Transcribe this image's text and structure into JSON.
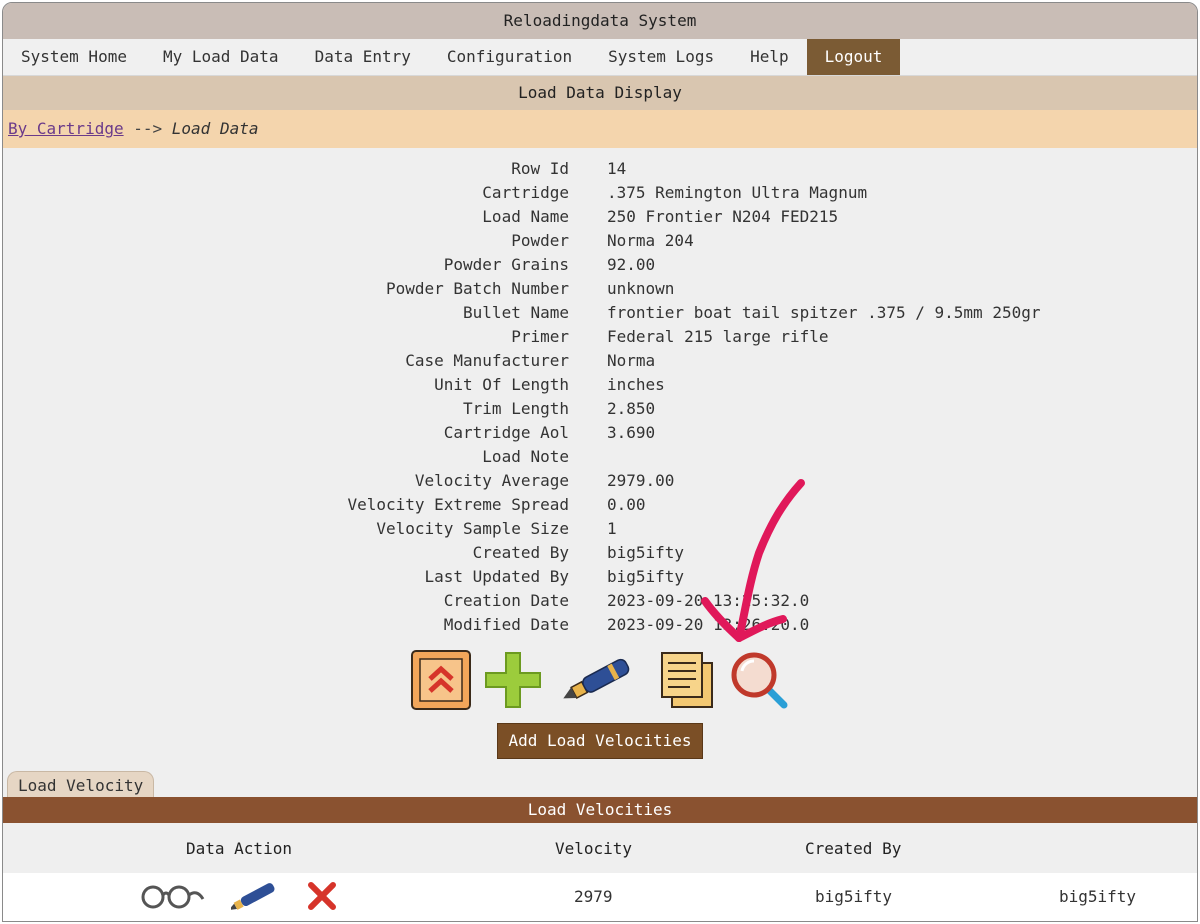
{
  "window": {
    "title": "Reloadingdata System"
  },
  "nav": {
    "items": [
      {
        "label": "System Home"
      },
      {
        "label": "My Load Data"
      },
      {
        "label": "Data Entry"
      },
      {
        "label": "Configuration"
      },
      {
        "label": "System Logs"
      },
      {
        "label": "Help"
      },
      {
        "label": "Logout"
      }
    ],
    "active": "Logout"
  },
  "section": {
    "title": "Load Data Display"
  },
  "breadcrumb": {
    "link": "By Cartridge",
    "separator": "-->",
    "current": "Load Data"
  },
  "details": [
    {
      "label": "Row Id",
      "value": "14"
    },
    {
      "label": "Cartridge",
      "value": ".375 Remington Ultra Magnum"
    },
    {
      "label": "Load Name",
      "value": "250 Frontier N204 FED215"
    },
    {
      "label": "Powder",
      "value": "Norma 204"
    },
    {
      "label": "Powder Grains",
      "value": "92.00"
    },
    {
      "label": "Powder Batch Number",
      "value": "unknown"
    },
    {
      "label": "Bullet Name",
      "value": "frontier boat tail spitzer .375 / 9.5mm 250gr"
    },
    {
      "label": "Primer",
      "value": "Federal 215 large rifle"
    },
    {
      "label": "Case Manufacturer",
      "value": "Norma"
    },
    {
      "label": "Unit Of Length",
      "value": "inches"
    },
    {
      "label": "Trim Length",
      "value": "2.850"
    },
    {
      "label": "Cartridge Aol",
      "value": "3.690"
    },
    {
      "label": "Load Note",
      "value": ""
    },
    {
      "label": "Velocity Average",
      "value": "2979.00"
    },
    {
      "label": "Velocity Extreme Spread",
      "value": "0.00"
    },
    {
      "label": "Velocity Sample Size",
      "value": "1"
    },
    {
      "label": "Created By",
      "value": "big5ifty"
    },
    {
      "label": "Last Updated By",
      "value": "big5ifty"
    },
    {
      "label": "Creation Date",
      "value": "2023-09-20 13:25:32.0"
    },
    {
      "label": "Modified Date",
      "value": "2023-09-20 13:26:20.0"
    }
  ],
  "actions": {
    "icons": [
      "back-to-top-icon",
      "add-icon",
      "edit-pen-icon",
      "copy-documents-icon",
      "search-magnifier-icon"
    ],
    "add_velocities_label": "Add Load Velocities"
  },
  "velocity_tab": {
    "label": "Load Velocity"
  },
  "velocities": {
    "title": "Load Velocities",
    "columns": [
      "Data Action",
      "Velocity",
      "Created By"
    ],
    "rows": [
      {
        "velocity": "2979",
        "created_by": "big5ifty",
        "updated_by": "big5ifty"
      }
    ],
    "row_icons": [
      "view-glasses-icon",
      "edit-pen-icon",
      "delete-x-icon"
    ]
  },
  "colors": {
    "accent": "#7b5b34",
    "header_bar": "#8a5230",
    "breadcrumb_bg": "#f4d5ad",
    "annotation": "#e0185a"
  }
}
